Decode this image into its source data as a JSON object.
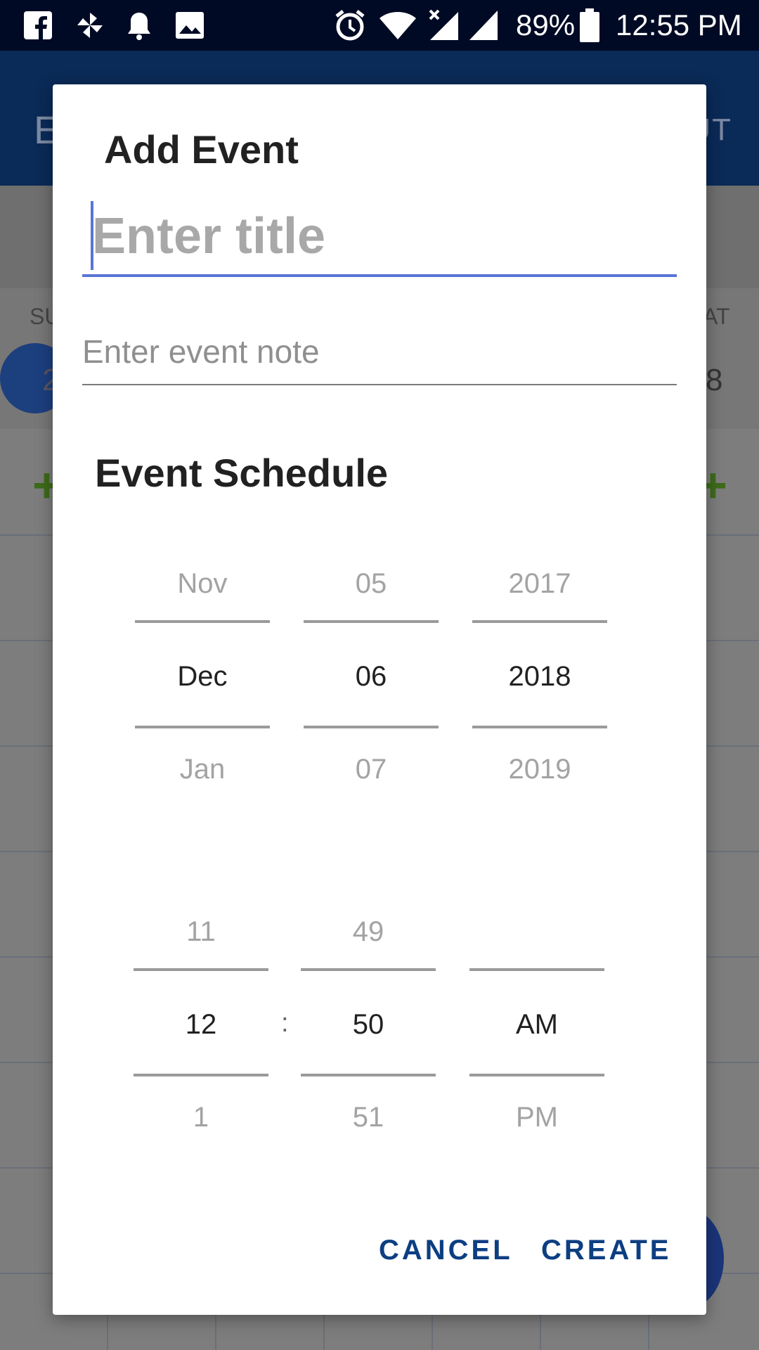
{
  "status_bar": {
    "icons": [
      "facebook-icon",
      "pinwheel-icon",
      "bell-icon",
      "image-icon",
      "alarm-icon",
      "wifi-icon",
      "signal-no-data-icon",
      "signal-icon",
      "battery-icon"
    ],
    "battery": "89%",
    "time": "12:55 PM"
  },
  "background_app": {
    "toolbar_title": "E",
    "toolbar_action": "UT",
    "weekday_left": "SU",
    "weekday_right": "AT",
    "day_left": "2",
    "day_right": "8"
  },
  "dialog": {
    "title": "Add Event",
    "title_placeholder": "Enter title",
    "note_placeholder": "Enter event note",
    "schedule_heading": "Event Schedule",
    "date_picker": {
      "month": {
        "prev": "Nov",
        "selected": "Dec",
        "next": "Jan"
      },
      "day": {
        "prev": "05",
        "selected": "06",
        "next": "07"
      },
      "year": {
        "prev": "2017",
        "selected": "2018",
        "next": "2019"
      }
    },
    "time_picker": {
      "hour": {
        "prev": "11",
        "selected": "12",
        "next": "1"
      },
      "separator": ":",
      "minute": {
        "prev": "49",
        "selected": "50",
        "next": "51"
      },
      "ampm": {
        "prev": "",
        "selected": "AM",
        "next": "PM"
      }
    },
    "cancel_label": "CANCEL",
    "create_label": "CREATE"
  },
  "colors": {
    "accent": "#5a75d6",
    "button_text": "#0d3e82",
    "status_bar": "#000a24"
  }
}
